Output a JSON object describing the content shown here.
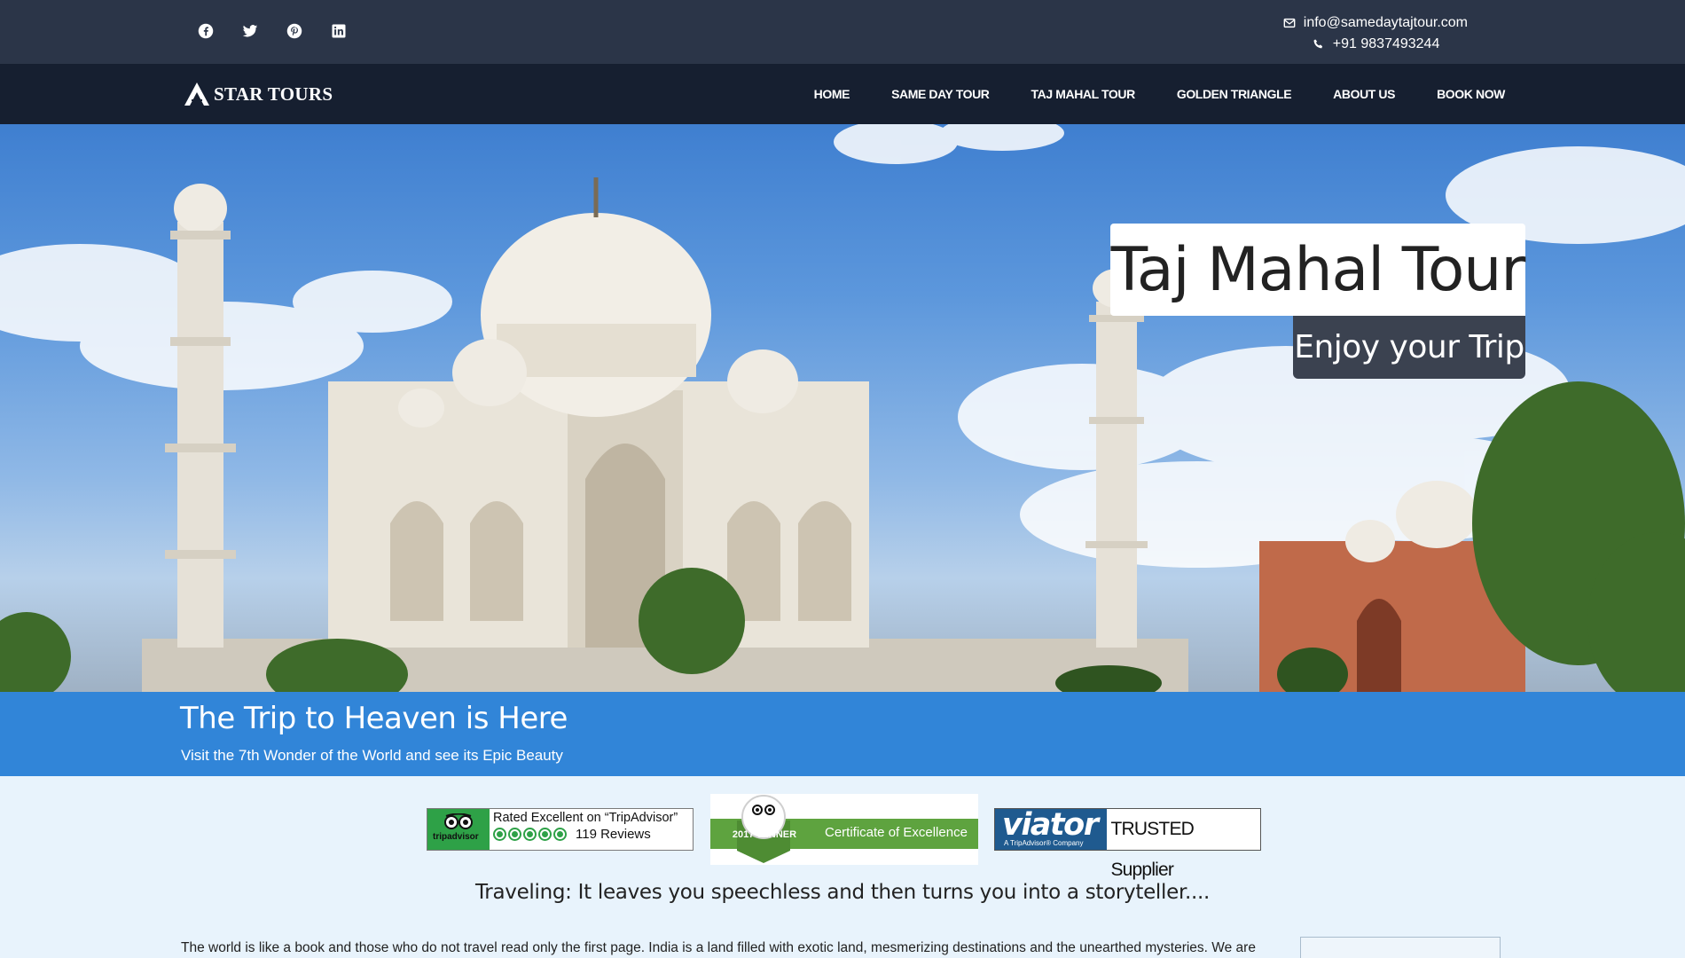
{
  "topbar": {
    "social": [
      "facebook-icon",
      "twitter-icon",
      "pinterest-icon",
      "linkedin-icon"
    ],
    "email": "info@samedaytajtour.com",
    "phone": "+91 9837493244"
  },
  "nav": {
    "logo": "STAR TOURS",
    "items": [
      "HOME",
      "SAME DAY TOUR",
      "TAJ MAHAL TOUR",
      "GOLDEN TRIANGLE",
      "ABOUT US",
      "BOOK NOW"
    ]
  },
  "hero": {
    "title": "Taj Mahal Tour",
    "subtitle": "Enjoy your Trip"
  },
  "band": {
    "heading": "The Trip to Heaven is Here",
    "subheading": "Visit the 7th Wonder of the World and see its Epic Beauty"
  },
  "badges": {
    "tripadvisor_rating": {
      "brand": "tripadvisor",
      "headline": "Rated Excellent on “TripAdvisor”",
      "reviews": "119 Reviews",
      "stars": 5
    },
    "certificate": {
      "brand": "tripadvisor",
      "winner": "2017 WINNER",
      "label": "Certificate of Excellence"
    },
    "viator": {
      "brand": "viator",
      "tagline": "A TripAdvisor® Company",
      "label": "TRUSTED Supplier"
    }
  },
  "quote": "Traveling: It leaves you speechless and then turns you into a storyteller....",
  "paragraph": "The world is like a book and those who do not travel read only the first page. India is a land filled with exotic land, mesmerizing destinations and the unearthed mysteries. We are",
  "colors": {
    "topbar": "#2b3548",
    "nav": "#161f30",
    "band": "#3185d8",
    "page_bg": "#e8f3fc",
    "tripadvisor_green": "#2ea147",
    "viator_blue": "#1f5a8f"
  }
}
